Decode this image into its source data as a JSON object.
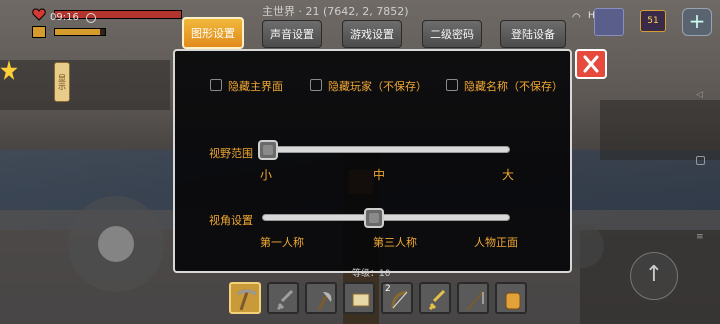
{
  "hud": {
    "clock": "09:16",
    "world_info": "主世界 · 21 (7642, 2, 7852)",
    "hdplus": "HD",
    "battery_level": "51",
    "health_percent": 100,
    "food_percent": 90,
    "side_tab_label": "显示"
  },
  "tabs": [
    {
      "label": "图形设置",
      "active": true
    },
    {
      "label": "声音设置",
      "active": false
    },
    {
      "label": "游戏设置",
      "active": false
    },
    {
      "label": "二级密码",
      "active": false
    },
    {
      "label": "登陆设备",
      "active": false
    }
  ],
  "settings": {
    "checkboxes": [
      {
        "label": "隐藏主界面",
        "checked": false
      },
      {
        "label": "隐藏玩家（不保存）",
        "checked": false
      },
      {
        "label": "隐藏名称（不保存）",
        "checked": false
      }
    ],
    "view_distance": {
      "label": "视野范围",
      "value_fraction": 0.0,
      "ticks": [
        "小",
        "中",
        "大"
      ]
    },
    "view_angle": {
      "label": "视角设置",
      "value_fraction": 0.45,
      "ticks": [
        "第一人称",
        "第三人称",
        "人物正面"
      ]
    }
  },
  "hotbar": {
    "level_text": "等级：10",
    "slots": [
      {
        "icon": "pickaxe-icon",
        "selected": true,
        "count": ""
      },
      {
        "icon": "stone-sword-icon",
        "selected": false,
        "count": ""
      },
      {
        "icon": "axe-icon",
        "selected": false,
        "count": ""
      },
      {
        "icon": "scroll-icon",
        "selected": false,
        "count": ""
      },
      {
        "icon": "bow-icon",
        "selected": false,
        "count": "2"
      },
      {
        "icon": "golden-sword-icon",
        "selected": false,
        "count": ""
      },
      {
        "icon": "fishing-rod-icon",
        "selected": false,
        "count": ""
      },
      {
        "icon": "backpack-icon",
        "selected": false,
        "count": ""
      }
    ]
  },
  "colors": {
    "accent_orange": "#f0a834",
    "active_tab": "#f0b93b",
    "close_red": "#e54a3c"
  }
}
